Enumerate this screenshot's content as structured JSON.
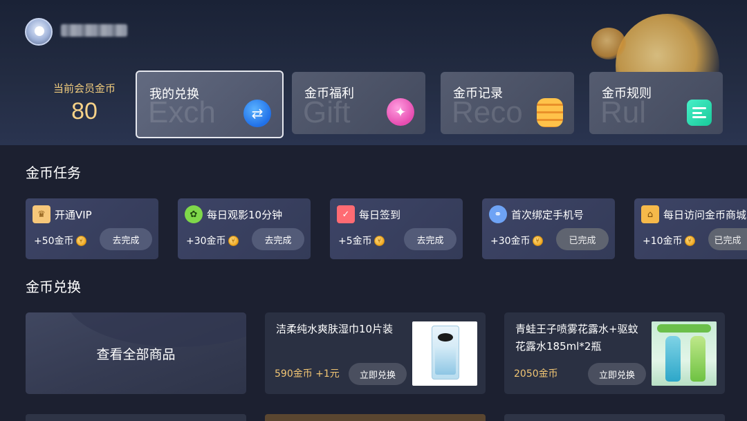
{
  "header": {
    "coins_label": "当前会员金币",
    "coins_value": "80"
  },
  "top_cards": [
    {
      "label": "我的兑换",
      "watermark": "Exch",
      "icon": "exchange-icon",
      "selected": true
    },
    {
      "label": "金币福利",
      "watermark": "Gift",
      "icon": "gift-bag-icon",
      "selected": false
    },
    {
      "label": "金币记录",
      "watermark": "Reco",
      "icon": "coin-stack-icon",
      "selected": false
    },
    {
      "label": "金币规则",
      "watermark": "Rul",
      "icon": "rules-document-icon",
      "selected": false
    }
  ],
  "tasks_section": {
    "title": "金币任务",
    "items": [
      {
        "title": "开通VIP",
        "reward": "+50金币",
        "button": "去完成",
        "done": false,
        "icon": "crown-icon"
      },
      {
        "title": "每日观影10分钟",
        "reward": "+30金币",
        "button": "去完成",
        "done": false,
        "icon": "film-reel-icon"
      },
      {
        "title": "每日签到",
        "reward": "+5金币",
        "button": "去完成",
        "done": false,
        "icon": "calendar-check-icon"
      },
      {
        "title": "首次绑定手机号",
        "reward": "+30金币",
        "button": "已完成",
        "done": true,
        "icon": "link-icon"
      },
      {
        "title": "每日访问金币商城",
        "reward": "+10金币",
        "button": "已完成",
        "done": true,
        "icon": "store-icon"
      }
    ]
  },
  "exchange_section": {
    "title": "金币兑换",
    "view_all": "查看全部商品",
    "products": [
      {
        "title": "洁柔纯水爽肤湿巾10片装",
        "price": "590金币 +1元",
        "button": "立即兑换"
      },
      {
        "title": "青蛙王子喷雾花露水+驱蚊花露水185ml*2瓶",
        "title_line1": "青蛙王子喷雾花露水+驱蚊",
        "title_line2": "花露水185ml*2瓶",
        "price": "2050金币",
        "button": "立即兑换"
      }
    ]
  },
  "colors": {
    "gold": "#f6d288",
    "background": "#1c2030",
    "task_card": "#3d4466",
    "price": "#f2c674"
  }
}
